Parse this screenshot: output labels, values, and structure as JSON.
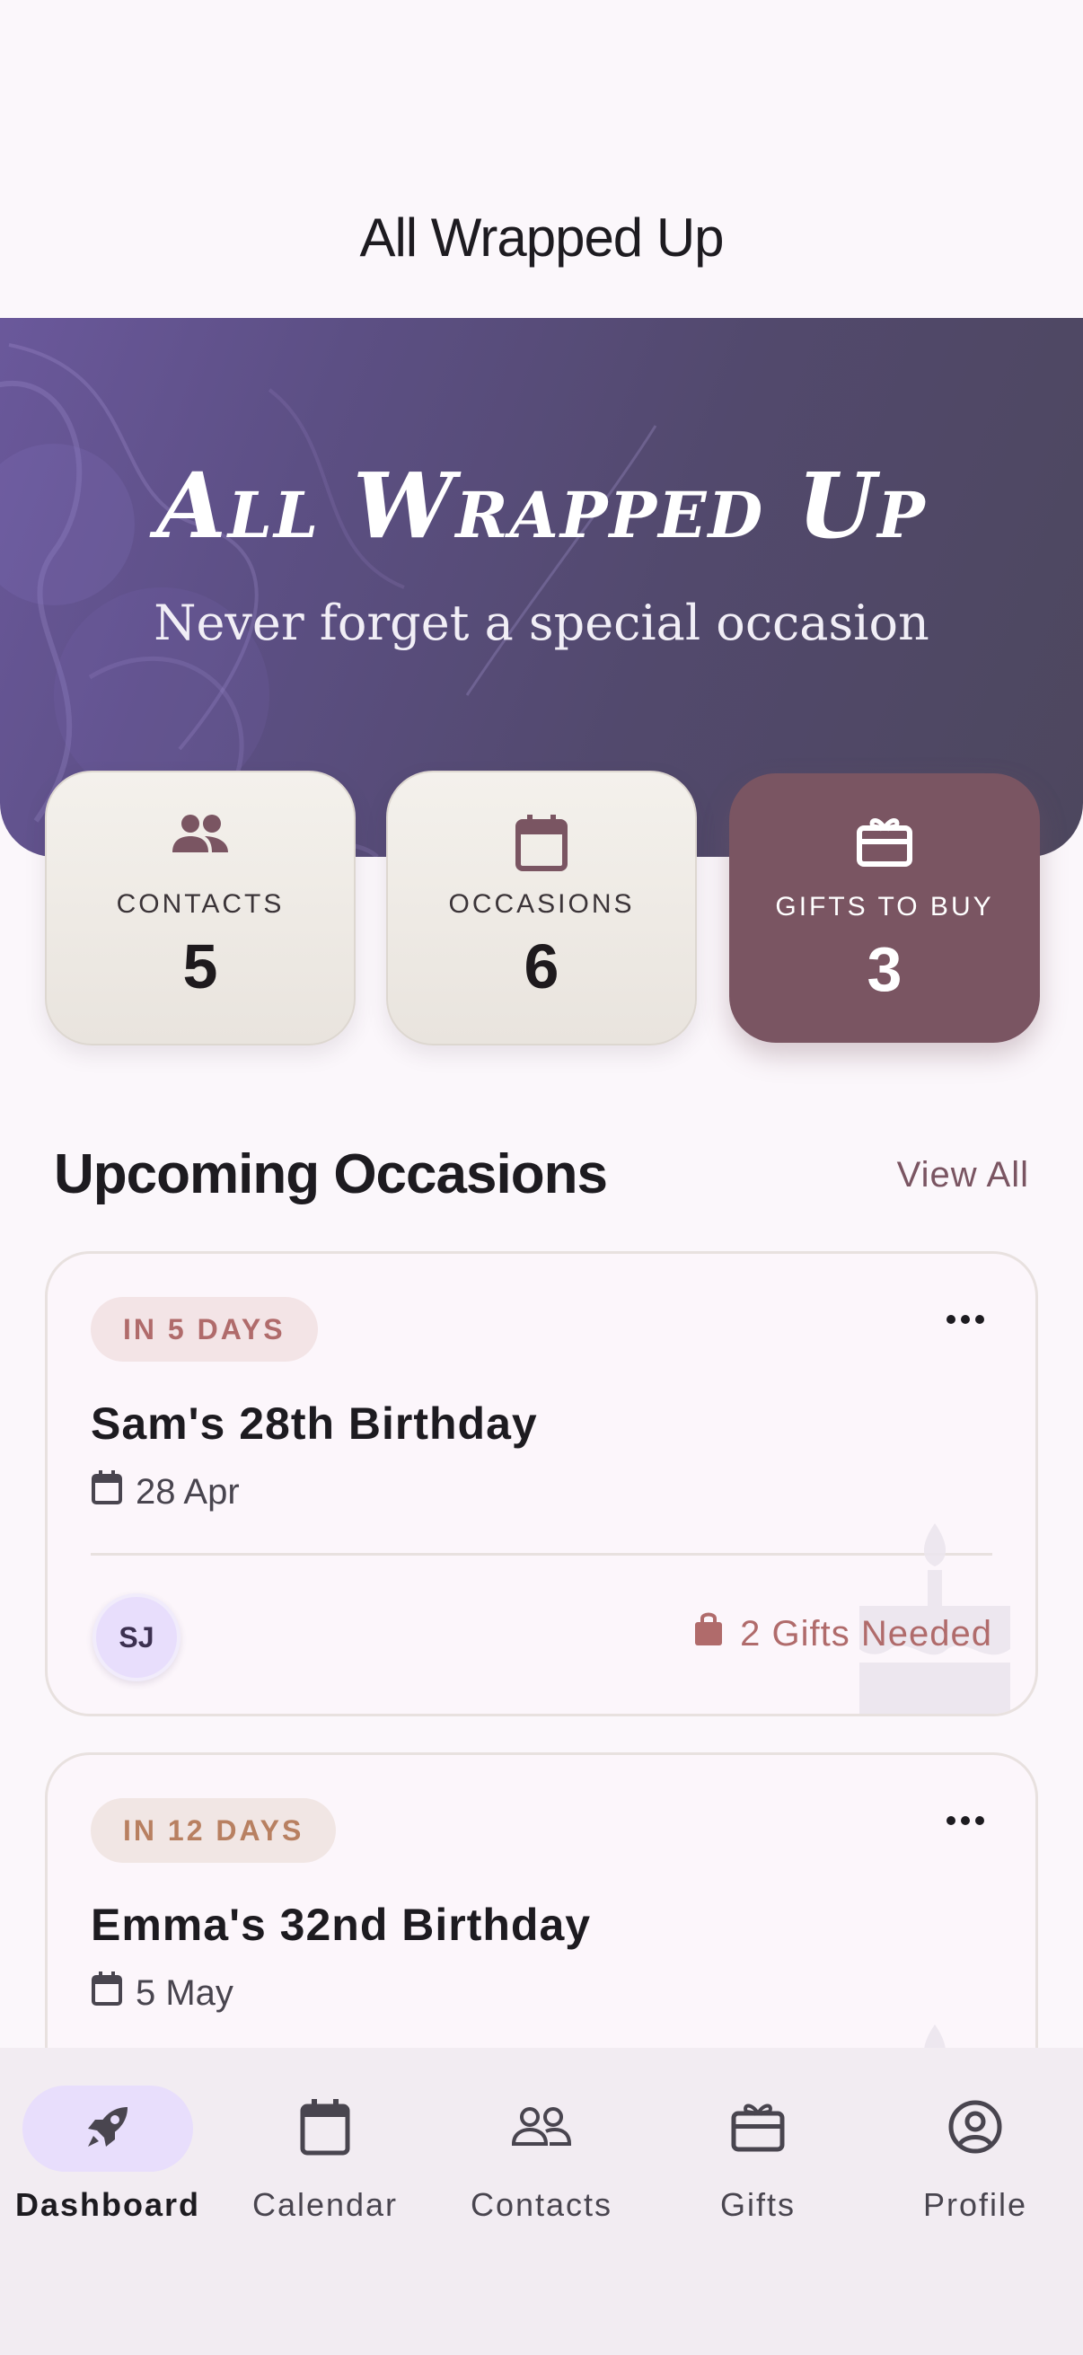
{
  "app": {
    "title": "All Wrapped Up"
  },
  "hero": {
    "title": "All Wrapped Up",
    "subtitle": "Never forget a special occasion"
  },
  "stats": [
    {
      "label": "CONTACTS",
      "value": "5",
      "icon": "people-icon"
    },
    {
      "label": "OCCASIONS",
      "value": "6",
      "icon": "calendar-icon"
    },
    {
      "label": "GIFTS TO BUY",
      "value": "3",
      "icon": "gift-icon"
    }
  ],
  "upcoming": {
    "title": "Upcoming Occasions",
    "view_all": "View All",
    "items": [
      {
        "badge": "IN 5 DAYS",
        "title": "Sam's 28th Birthday",
        "date": "28 Apr",
        "avatar": "SJ",
        "gifts": "2 Gifts Needed"
      },
      {
        "badge": "IN 12 DAYS",
        "title": "Emma's 32nd Birthday",
        "date": "5 May"
      }
    ]
  },
  "nav": [
    {
      "label": "Dashboard",
      "icon": "rocket-icon",
      "active": true
    },
    {
      "label": "Calendar",
      "icon": "calendar-icon"
    },
    {
      "label": "Contacts",
      "icon": "people-icon"
    },
    {
      "label": "Gifts",
      "icon": "gift-icon"
    },
    {
      "label": "Profile",
      "icon": "account-circle-icon"
    }
  ],
  "colors": {
    "accent": "#7a5562",
    "badge_text": "#b06b6b",
    "hero_start": "#6a589b",
    "hero_end": "#4d475e",
    "nav_active": "#e8defc"
  }
}
